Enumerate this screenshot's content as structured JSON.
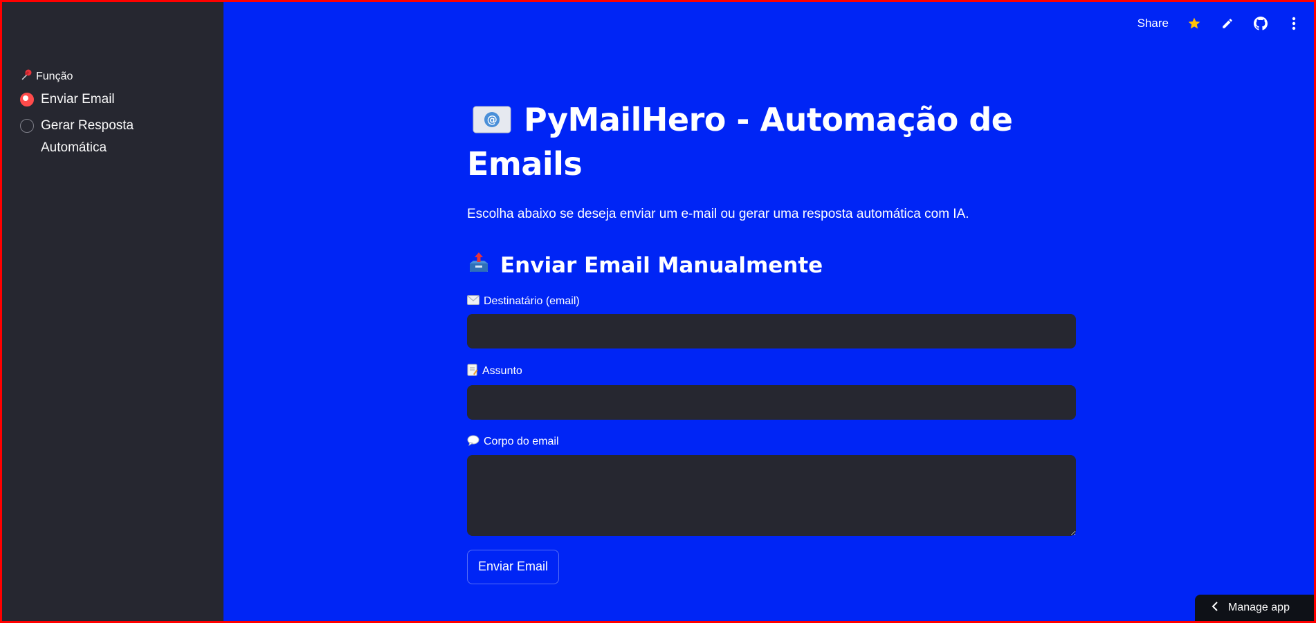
{
  "sidebar": {
    "section_label": "Função",
    "section_icon": "pushpin-icon",
    "options": [
      {
        "label": "Enviar Email",
        "checked": true
      },
      {
        "label": "Gerar Resposta Automática",
        "checked": false
      }
    ]
  },
  "toolbar": {
    "share_label": "Share",
    "icons": [
      "star-icon",
      "pencil-icon",
      "github-icon",
      "more-vertical-icon"
    ]
  },
  "main": {
    "title": "PyMailHero - Automação de Emails",
    "title_icon": "envelope-at-icon",
    "subtitle": "Escolha abaixo se deseja enviar um e-mail ou gerar uma resposta automática com IA.",
    "section_title": "Enviar Email Manualmente",
    "section_icon": "outbox-tray-icon",
    "fields": {
      "recipient_label": "Destinatário (email)",
      "recipient_value": "",
      "subject_label": "Assunto",
      "subject_value": "",
      "body_label": "Corpo do email",
      "body_value": ""
    },
    "send_button": "Enviar Email"
  },
  "footer": {
    "manage_app": "Manage app"
  },
  "colors": {
    "background": "#0025f5",
    "sidebar": "#262730",
    "accent": "#ff4b4b",
    "frame_border": "#ff0000"
  }
}
